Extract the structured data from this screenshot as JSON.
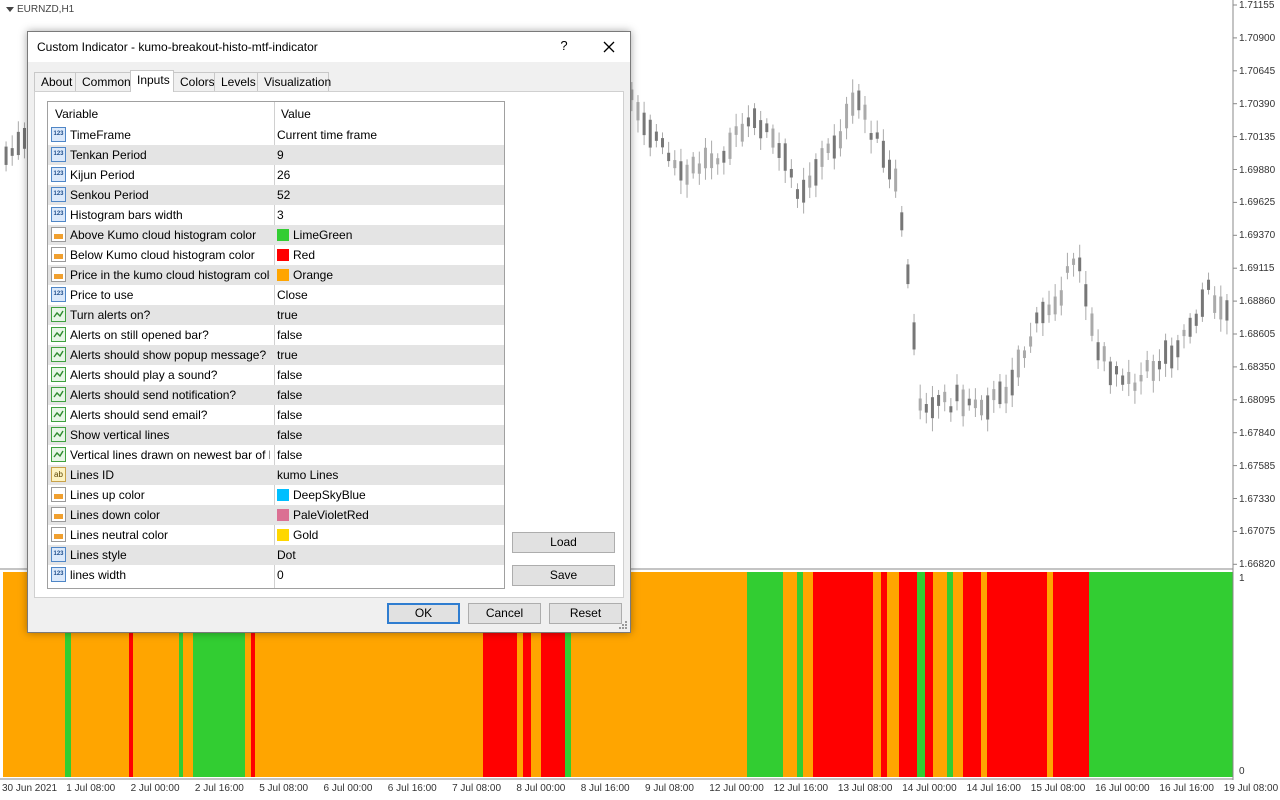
{
  "chart": {
    "symbol": "EURNZD,H1",
    "histogram_top_label": "1",
    "histogram_bottom_label": "0",
    "price_axis": [
      "1.71155",
      "1.70900",
      "1.70645",
      "1.70390",
      "1.70135",
      "1.69880",
      "1.69625",
      "1.69370",
      "1.69115",
      "1.68860",
      "1.68605",
      "1.68350",
      "1.68095",
      "1.67840",
      "1.67585",
      "1.67330",
      "1.67075",
      "1.66820"
    ],
    "time_axis": [
      "30 Jun 2021",
      "1 Jul 08:00",
      "2 Jul 00:00",
      "2 Jul 16:00",
      "5 Jul 08:00",
      "6 Jul 00:00",
      "6 Jul 16:00",
      "7 Jul 08:00",
      "8 Jul 00:00",
      "8 Jul 16:00",
      "9 Jul 08:00",
      "12 Jul 00:00",
      "12 Jul 16:00",
      "13 Jul 08:00",
      "14 Jul 00:00",
      "14 Jul 16:00",
      "15 Jul 08:00",
      "16 Jul 00:00",
      "16 Jul 16:00",
      "19 Jul 08:00"
    ],
    "colors": {
      "up": "#32cd32",
      "down": "#ff0000",
      "inside": "#ffa500",
      "candle": "#aaaaaa"
    },
    "histogram_sequence": [
      "inside",
      "up",
      "inside",
      "down",
      "inside",
      "up",
      "inside",
      "up",
      "inside",
      "down",
      "inside",
      "down",
      "inside",
      "down",
      "inside",
      "down",
      "up",
      "inside",
      "up",
      "inside",
      "up",
      "inside",
      "down",
      "inside",
      "down",
      "inside",
      "down",
      "up",
      "down",
      "inside",
      "up",
      "inside",
      "down",
      "inside",
      "down",
      "inside",
      "down",
      "up"
    ]
  },
  "dialog": {
    "title": "Custom Indicator - kumo-breakout-histo-mtf-indicator",
    "help": "?",
    "tabs": [
      "About",
      "Common",
      "Inputs",
      "Colors",
      "Levels",
      "Visualization"
    ],
    "active_tab": "Inputs",
    "grid": {
      "col_variable": "Variable",
      "col_value": "Value",
      "rows": [
        {
          "icon": "num",
          "variable": "TimeFrame",
          "value": "Current time frame"
        },
        {
          "icon": "num",
          "variable": "Tenkan Period",
          "value": "9"
        },
        {
          "icon": "num",
          "variable": "Kijun Period",
          "value": "26"
        },
        {
          "icon": "num",
          "variable": "Senkou Period",
          "value": "52"
        },
        {
          "icon": "num",
          "variable": "Histogram bars width",
          "value": "3"
        },
        {
          "icon": "color",
          "variable": "Above Kumo cloud histogram color",
          "value": "LimeGreen",
          "swatch": "#32cd32"
        },
        {
          "icon": "color",
          "variable": "Below Kumo cloud histogram color",
          "value": "Red",
          "swatch": "#ff0000"
        },
        {
          "icon": "color",
          "variable": "Price in the kumo cloud histogram color",
          "value": "Orange",
          "swatch": "#ffa500"
        },
        {
          "icon": "num",
          "variable": "Price to use",
          "value": "Close"
        },
        {
          "icon": "bool",
          "variable": "Turn alerts on?",
          "value": "true"
        },
        {
          "icon": "bool",
          "variable": "Alerts on still opened bar?",
          "value": "false"
        },
        {
          "icon": "bool",
          "variable": "Alerts should show popup message?",
          "value": "true"
        },
        {
          "icon": "bool",
          "variable": "Alerts should play a sound?",
          "value": "false"
        },
        {
          "icon": "bool",
          "variable": "Alerts should send notification?",
          "value": "false"
        },
        {
          "icon": "bool",
          "variable": "Alerts should send email?",
          "value": "false"
        },
        {
          "icon": "bool",
          "variable": "Show vertical lines",
          "value": "false"
        },
        {
          "icon": "bool",
          "variable": "Vertical lines drawn on newest bar of hig...",
          "value": "false"
        },
        {
          "icon": "str",
          "variable": "Lines ID",
          "value": "kumo Lines"
        },
        {
          "icon": "color",
          "variable": "Lines up color",
          "value": "DeepSkyBlue",
          "swatch": "#00bfff"
        },
        {
          "icon": "color",
          "variable": "Lines down color",
          "value": "PaleVioletRed",
          "swatch": "#db7093"
        },
        {
          "icon": "color",
          "variable": "Lines neutral color",
          "value": "Gold",
          "swatch": "#ffd700"
        },
        {
          "icon": "num",
          "variable": "Lines style",
          "value": "Dot"
        },
        {
          "icon": "num",
          "variable": "lines width",
          "value": "0"
        }
      ]
    },
    "buttons": {
      "load": "Load",
      "save": "Save",
      "ok": "OK",
      "cancel": "Cancel",
      "reset": "Reset"
    }
  }
}
